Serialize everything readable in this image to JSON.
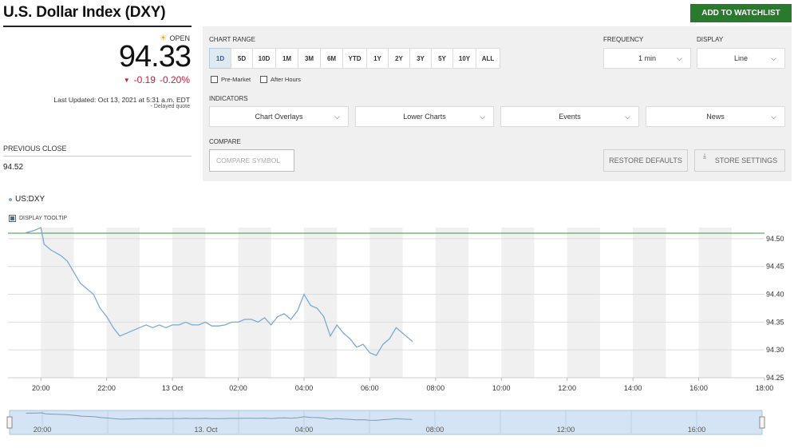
{
  "header": {
    "title": "U.S. Dollar Index (DXY)",
    "watchlist_label": "ADD TO WATCHLIST",
    "accent": "#2a7a2d"
  },
  "quote": {
    "status": "OPEN",
    "status_icon": "sun-icon",
    "price": "94.33",
    "change": "-0.19",
    "change_pct": "-0.20%",
    "change_color": "#c0203b",
    "change_icon": "down-triangle-icon",
    "last_updated": "Last Updated: Oct 13, 2021 at 5:31 a.m. EDT",
    "delayed": "Delayed quote",
    "prev_close_label": "PREVIOUS CLOSE",
    "prev_close": "94.52"
  },
  "panel": {
    "chart_range_label": "CHART RANGE",
    "ranges": [
      "1D",
      "5D",
      "10D",
      "1M",
      "3M",
      "6M",
      "YTD",
      "1Y",
      "2Y",
      "3Y",
      "5Y",
      "10Y",
      "ALL"
    ],
    "active_range": "1D",
    "premarket_label": "Pre-Market",
    "afterhours_label": "After Hours",
    "frequency_label": "FREQUENCY",
    "frequency_value": "1 min",
    "display_label": "DISPLAY",
    "display_value": "Line",
    "indicators_label": "INDICATORS",
    "indicators": [
      "Chart Overlays",
      "Lower Charts",
      "Events",
      "News"
    ],
    "compare_label": "COMPARE",
    "compare_placeholder": "COMPARE SYMBOL",
    "restore_label": "RESTORE DEFAULTS",
    "store_label": "STORE SETTINGS"
  },
  "chart": {
    "legend": "US:DXY",
    "tooltip_label": "DISPLAY TOOLTIP"
  },
  "chart_data": {
    "type": "line",
    "symbol": "US:DXY",
    "x_ticks": [
      "20:00",
      "22:00",
      "13 Oct",
      "02:00",
      "04:00",
      "06:00",
      "08:00",
      "10:00",
      "12:00",
      "14:00",
      "16:00",
      "18:00"
    ],
    "navigator_ticks": [
      "20:00",
      "13. Oct",
      "04:00",
      "08:00",
      "12:00",
      "16:00"
    ],
    "y_ticks": [
      "94.50",
      "94.45",
      "94.40",
      "94.35",
      "94.30",
      "94.25"
    ],
    "ylim": [
      94.25,
      94.52
    ],
    "reference_line": {
      "label": "Previous Close",
      "value": 94.51,
      "color": "#3a9a3a"
    },
    "series": [
      {
        "color": "#7aaad6",
        "points": [
          [
            19.5,
            94.51
          ],
          [
            19.8,
            94.515
          ],
          [
            20.0,
            94.52
          ],
          [
            20.1,
            94.49
          ],
          [
            20.3,
            94.48
          ],
          [
            20.6,
            94.47
          ],
          [
            20.8,
            94.46
          ],
          [
            21.0,
            94.44
          ],
          [
            21.2,
            94.42
          ],
          [
            21.4,
            94.41
          ],
          [
            21.6,
            94.4
          ],
          [
            21.8,
            94.375
          ],
          [
            22.0,
            94.36
          ],
          [
            22.2,
            94.34
          ],
          [
            22.4,
            94.325
          ],
          [
            22.6,
            94.33
          ],
          [
            22.8,
            94.335
          ],
          [
            23.0,
            94.34
          ],
          [
            23.2,
            94.345
          ],
          [
            23.4,
            94.34
          ],
          [
            23.6,
            94.345
          ],
          [
            23.8,
            94.34
          ],
          [
            24.0,
            94.345
          ],
          [
            24.2,
            94.345
          ],
          [
            24.4,
            94.35
          ],
          [
            24.6,
            94.345
          ],
          [
            24.8,
            94.345
          ],
          [
            25.0,
            94.35
          ],
          [
            25.2,
            94.343
          ],
          [
            25.4,
            94.343
          ],
          [
            25.6,
            94.345
          ],
          [
            25.8,
            94.35
          ],
          [
            26.0,
            94.35
          ],
          [
            26.2,
            94.355
          ],
          [
            26.4,
            94.355
          ],
          [
            26.6,
            94.35
          ],
          [
            26.8,
            94.358
          ],
          [
            27.0,
            94.345
          ],
          [
            27.2,
            94.36
          ],
          [
            27.4,
            94.365
          ],
          [
            27.6,
            94.355
          ],
          [
            27.8,
            94.37
          ],
          [
            28.0,
            94.4
          ],
          [
            28.2,
            94.38
          ],
          [
            28.4,
            94.375
          ],
          [
            28.6,
            94.36
          ],
          [
            28.8,
            94.325
          ],
          [
            29.0,
            94.345
          ],
          [
            29.2,
            94.33
          ],
          [
            29.4,
            94.32
          ],
          [
            29.6,
            94.305
          ],
          [
            29.8,
            94.31
          ],
          [
            30.0,
            94.295
          ],
          [
            30.2,
            94.29
          ],
          [
            30.4,
            94.31
          ],
          [
            30.6,
            94.32
          ],
          [
            30.8,
            94.34
          ],
          [
            31.0,
            94.33
          ],
          [
            31.2,
            94.32
          ],
          [
            31.3,
            94.315
          ]
        ]
      }
    ],
    "grid": true,
    "shaded_hour_bands": true,
    "navigator": true
  }
}
